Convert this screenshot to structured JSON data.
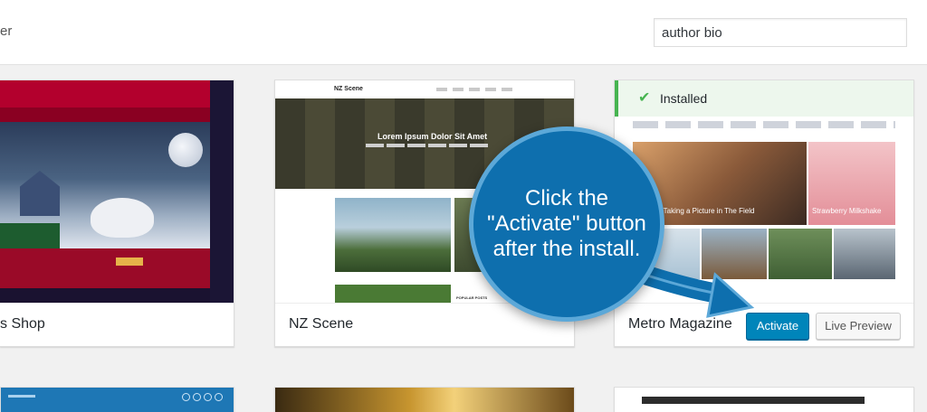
{
  "topbar": {
    "filter_label_fragment": "er",
    "search_value": "author bio"
  },
  "themes": [
    {
      "name": "s Shop"
    },
    {
      "name": "NZ Scene",
      "hero_title": "Lorem Ipsum Dolor Sit Amet",
      "popular_label": "POPULAR POSTS"
    },
    {
      "name": "Metro Magazine",
      "status": "Installed",
      "activate_label": "Activate",
      "preview_label": "Live Preview",
      "captions": [
        "grapher Taking a Picture in The Field",
        "Strawberry Milkshake"
      ]
    }
  ],
  "callout": {
    "text": "Click the\n\"Activate\" button\nafter the install."
  },
  "colors": {
    "primary_button": "#0085ba",
    "callout_bg": "#0e6fae",
    "callout_border": "#5ca8d8",
    "installed_green": "#46b450"
  },
  "icons": {
    "installed": "check-icon",
    "pointer": "arrow-icon"
  }
}
